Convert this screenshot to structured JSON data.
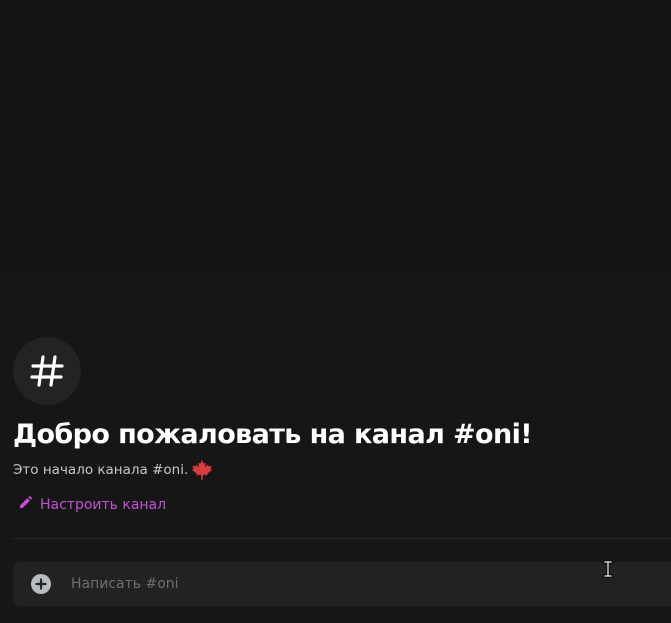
{
  "welcome": {
    "icon": "hashtag-icon",
    "title": "Добро пожаловать на канал #oni!",
    "subtitle": "Это начало канала #oni.",
    "emoji_icon": "maple-leaf-icon",
    "edit_icon": "pencil-icon",
    "edit_label": "Настроить канал"
  },
  "composer": {
    "add_icon": "plus-circle-icon",
    "placeholder": "Написать #oni",
    "value": ""
  },
  "cursor": {
    "icon": "text-cursor-icon"
  },
  "colors": {
    "background": "#151515",
    "accent": "#c54fd6",
    "composer_bg": "#222222",
    "leaf": "#d83c3e"
  }
}
